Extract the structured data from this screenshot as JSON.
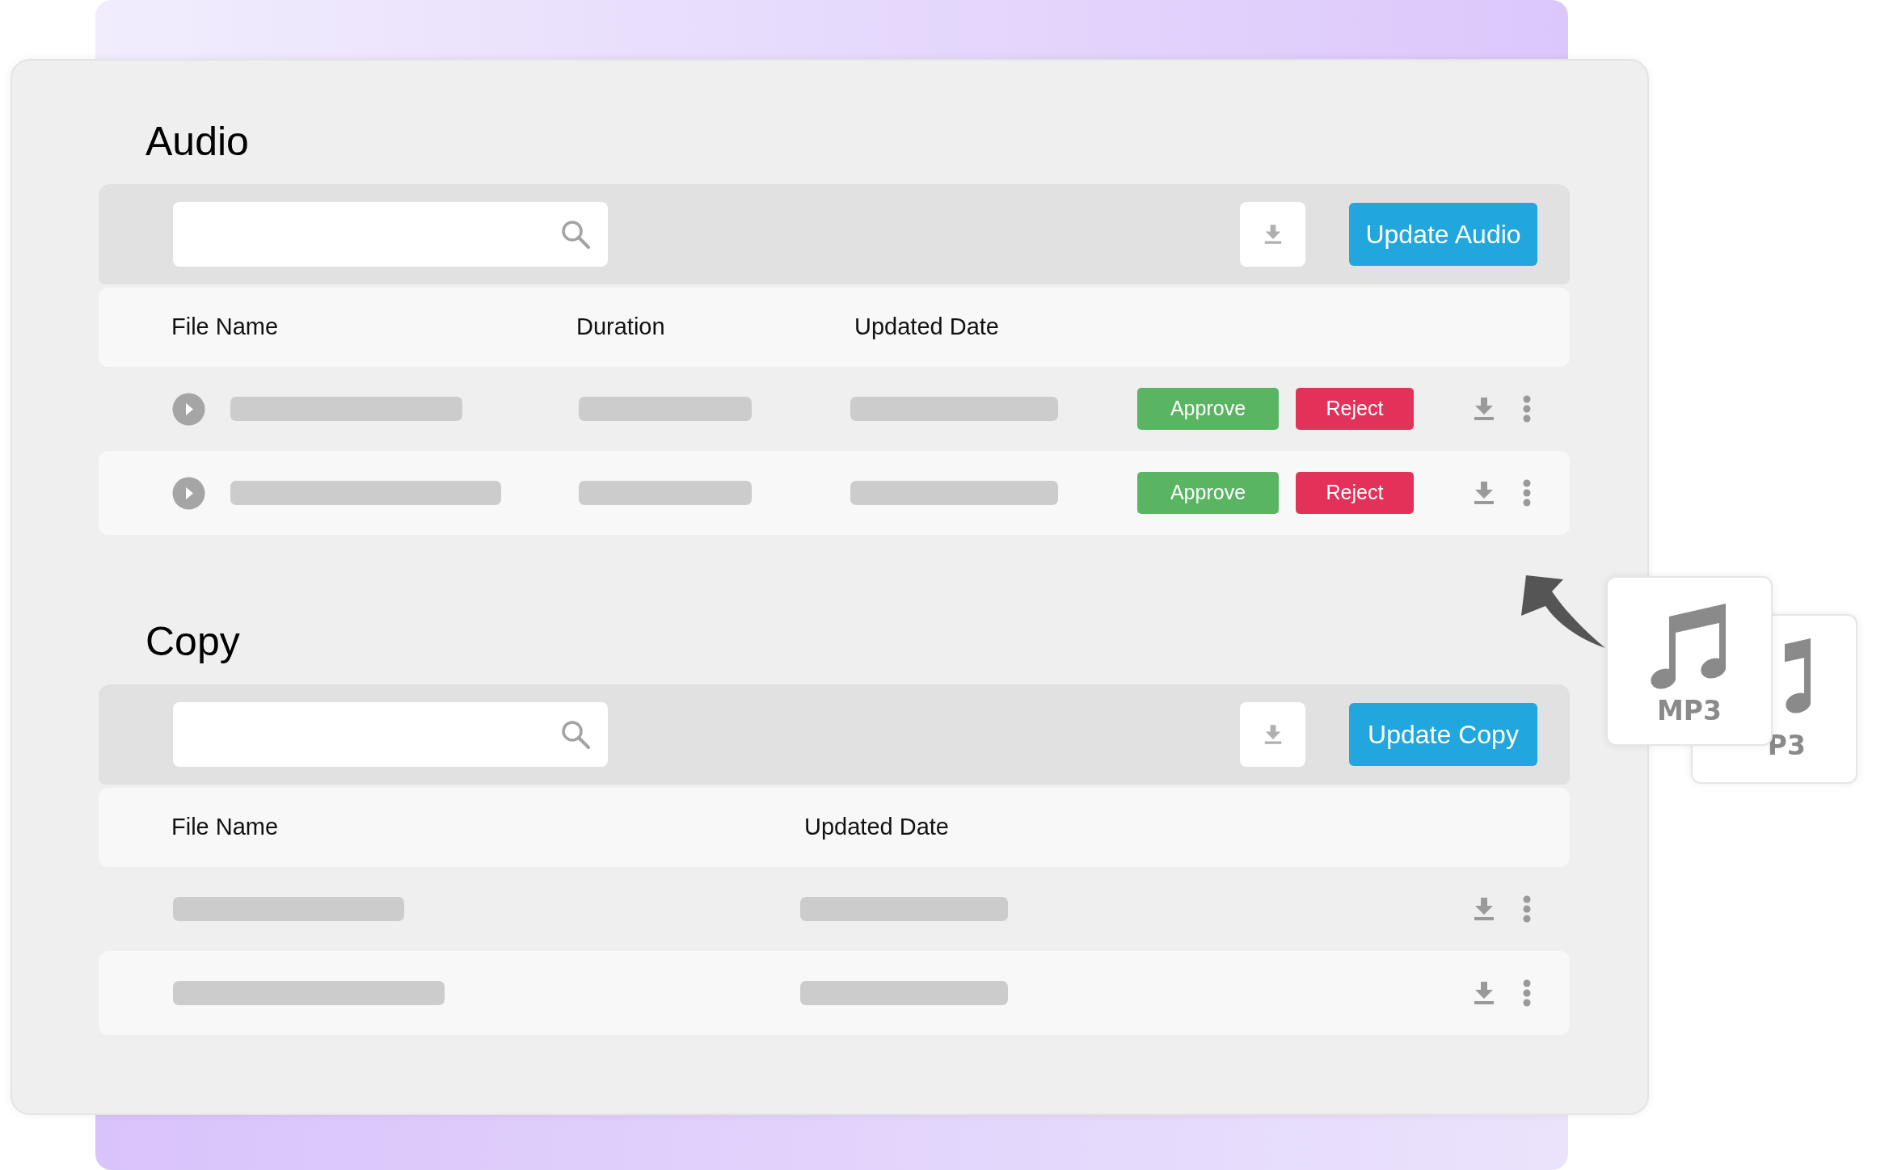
{
  "sections": [
    {
      "title": "Audio",
      "update_button": "Update Audio",
      "columns": [
        "File Name",
        "Duration",
        "Updated Date"
      ],
      "rows": [
        {
          "kind": "audio",
          "approve": "Approve",
          "reject": "Reject"
        },
        {
          "kind": "audio",
          "approve": "Approve",
          "reject": "Reject"
        }
      ]
    },
    {
      "title": "Copy",
      "update_button": "Update Copy",
      "columns": [
        "File Name",
        "Updated Date"
      ],
      "rows": [
        {
          "kind": "file"
        },
        {
          "kind": "file"
        }
      ]
    }
  ],
  "file_cards": [
    {
      "label": "MP3"
    },
    {
      "label": "P3"
    }
  ]
}
